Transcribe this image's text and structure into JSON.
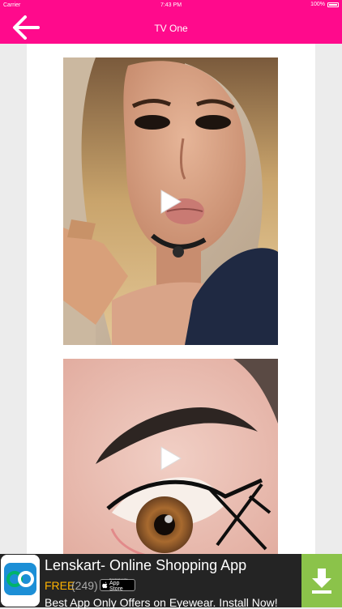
{
  "status_bar": {
    "carrier": "Carrier",
    "time": "7:43 PM",
    "battery": "100%"
  },
  "nav": {
    "title": "TV One",
    "back_icon": "arrow-left-icon"
  },
  "colors": {
    "brand": "#ff0a8c",
    "ad_background": "#242424",
    "ad_price": "#ffb300",
    "download_green": "#8bc34a"
  },
  "videos": [
    {
      "kind": "video-thumbnail",
      "icon": "play-icon"
    },
    {
      "kind": "video-thumbnail",
      "icon": "play-icon"
    }
  ],
  "ad": {
    "title": "Lenskart- Online Shopping App",
    "price": "FREE",
    "rating_count": "(249)",
    "badge_small": "Download on the",
    "badge_big": "App Store",
    "description": "Best App Only Offers on Eyewear. Install Now!",
    "download_icon": "download-arrow-icon"
  }
}
